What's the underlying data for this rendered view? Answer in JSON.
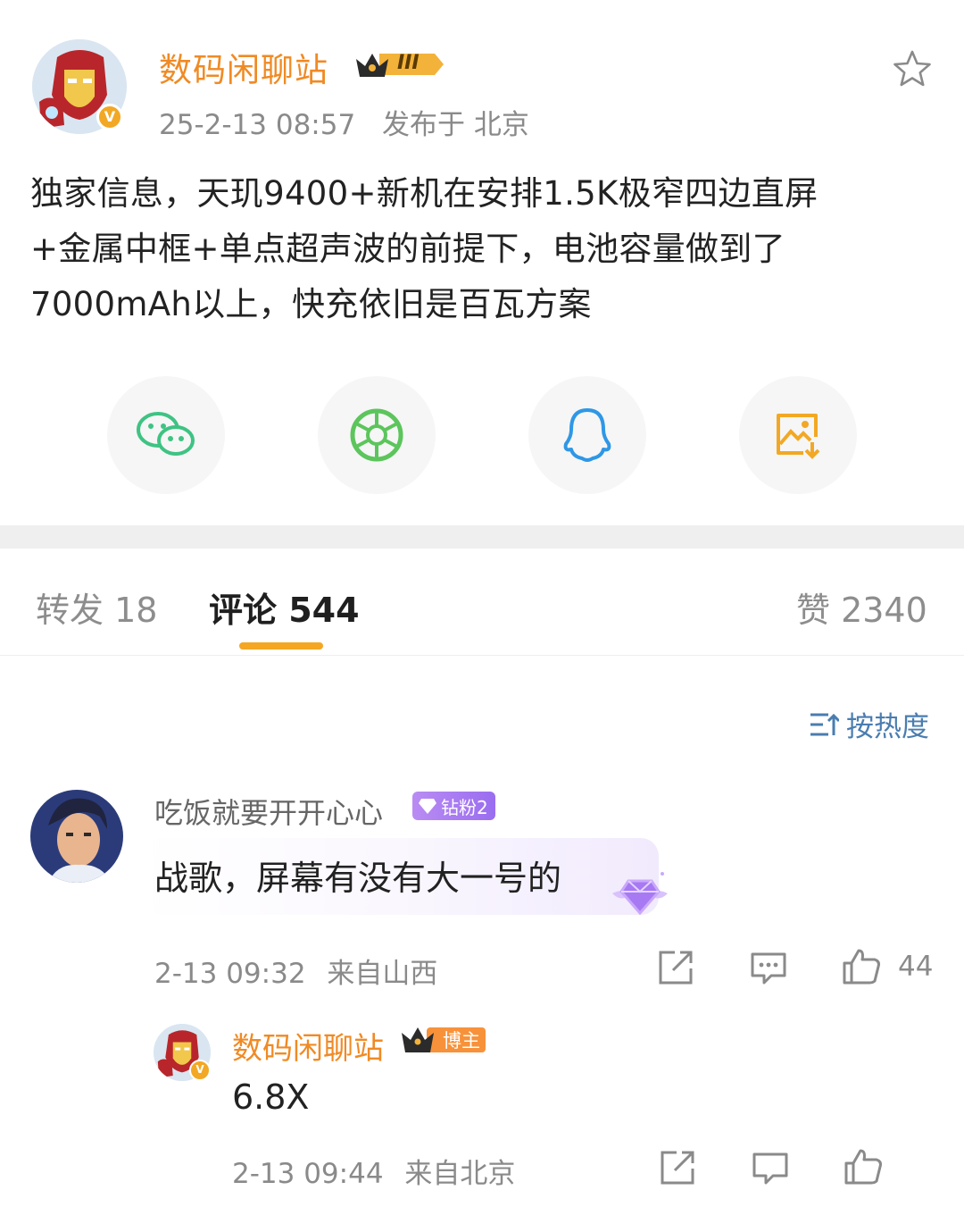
{
  "post": {
    "author": "数码闲聊站",
    "level_badge": "III",
    "time": "25-2-13 08:57",
    "location": "发布于 北京",
    "text": "独家信息，天玑9400+新机在安排1.5K极窄四边直屏\n+金属中框+单点超声波的前提下，电池容量做到了\n7000mAh以上，快充依旧是百瓦方案"
  },
  "share_targets": [
    "wechat-icon",
    "moments-icon",
    "qq-icon",
    "save-image-icon"
  ],
  "tabs": {
    "repost": "转发 18",
    "comment": "评论 544",
    "like": "赞 2340"
  },
  "sort_label": "按热度",
  "comment": {
    "user": "吃饭就要开开心心",
    "fan_badge": "钻粉2",
    "text": "战歌，屏幕有没有大一号的",
    "time": "2-13 09:32",
    "location": "来自山西",
    "likes": "44"
  },
  "reply": {
    "user": "数码闲聊站",
    "badge": "博主",
    "text": "6.8X",
    "time": "2-13 09:44",
    "location": "来自北京"
  },
  "colors": {
    "author_orange": "#f08a24",
    "accent_gold": "#f5a623",
    "link_blue": "#4a7db0",
    "wechat_green": "#3ec383",
    "qq_blue": "#2f97e6"
  }
}
